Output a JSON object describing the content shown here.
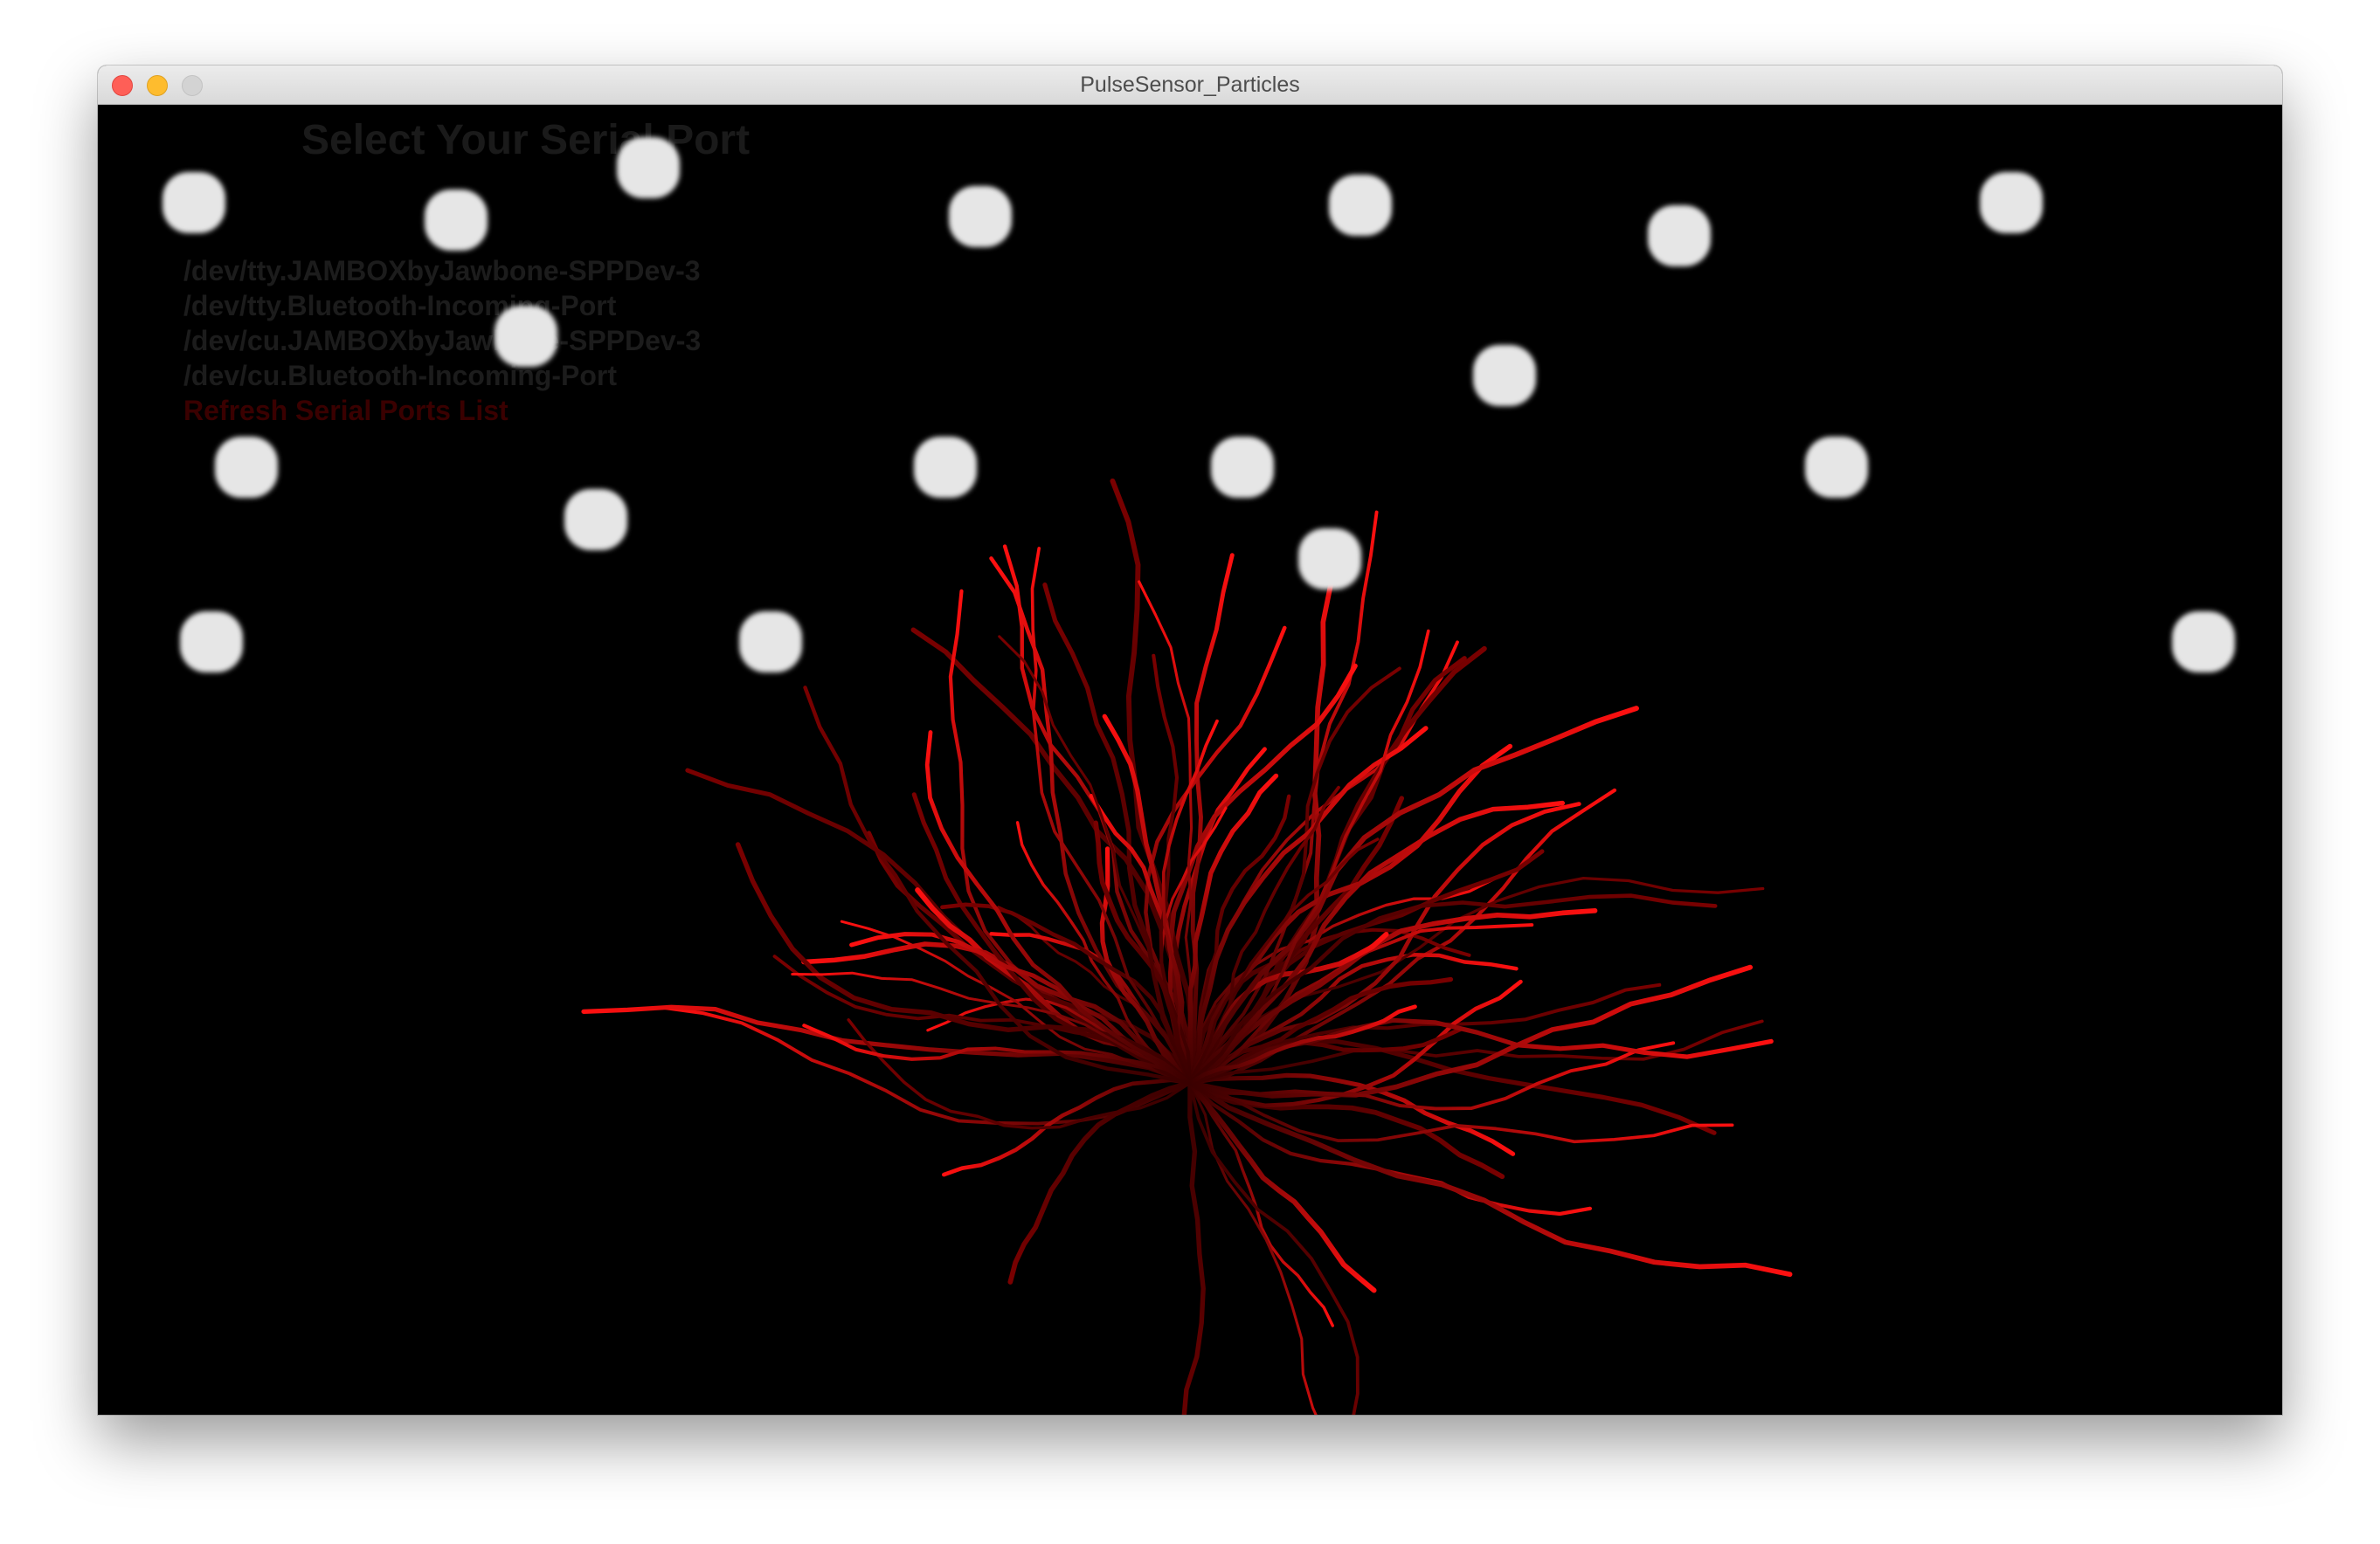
{
  "window": {
    "title": "PulseSensor_Particles"
  },
  "port_menu": {
    "title": "Select Your Serial Port",
    "ports": [
      "/dev/tty.JAMBOXbyJawbone-SPPDev-3",
      "/dev/tty.Bluetooth-Incoming-Port",
      "/dev/cu.JAMBOXbyJawbone-SPPDev-3",
      "/dev/cu.Bluetooth-Incoming-Port"
    ],
    "refresh_label": "Refresh Serial Ports List"
  },
  "colors": {
    "canvas": "#000000",
    "trail": "#ff1010",
    "particle": "#e6e6e6"
  },
  "particle_count": 19,
  "trail_count": 90
}
